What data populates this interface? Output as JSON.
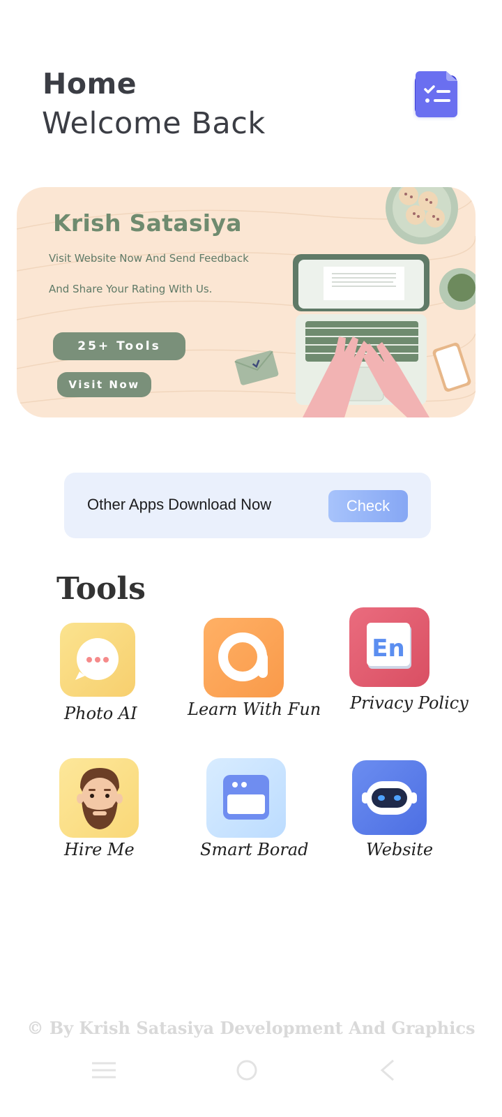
{
  "header": {
    "title": "Home",
    "subtitle": "Welcome Back",
    "menu_icon": "checklist-icon"
  },
  "banner": {
    "name": "Krish Satasiya",
    "line1": "Visit Website Now And Send Feedback",
    "line2": "And Share Your Rating With Us.",
    "tools_button": "25+ Tools",
    "visit_button": "Visit Now"
  },
  "apps_card": {
    "text": "Other Apps Download Now",
    "button": "Check"
  },
  "tools": {
    "title": "Tools",
    "items": [
      {
        "label": "Photo AI",
        "icon": "chat-bubble-icon"
      },
      {
        "label": "Learn With Fun",
        "icon": "letter-a-icon"
      },
      {
        "label": "Privacy Policy",
        "icon": "en-card-icon"
      },
      {
        "label": "Hire Me",
        "icon": "avatar-face-icon"
      },
      {
        "label": "Smart Borad",
        "icon": "window-icon"
      },
      {
        "label": "Website",
        "icon": "robot-icon"
      }
    ]
  },
  "footer": {
    "text": "© By Krish Satasiya Development And Graphics"
  },
  "colors": {
    "banner_bg": "#fbe6d3",
    "banner_accent": "#7a907a",
    "apps_card_bg": "#eaf0fc",
    "check_button": "#8fb0f7"
  }
}
